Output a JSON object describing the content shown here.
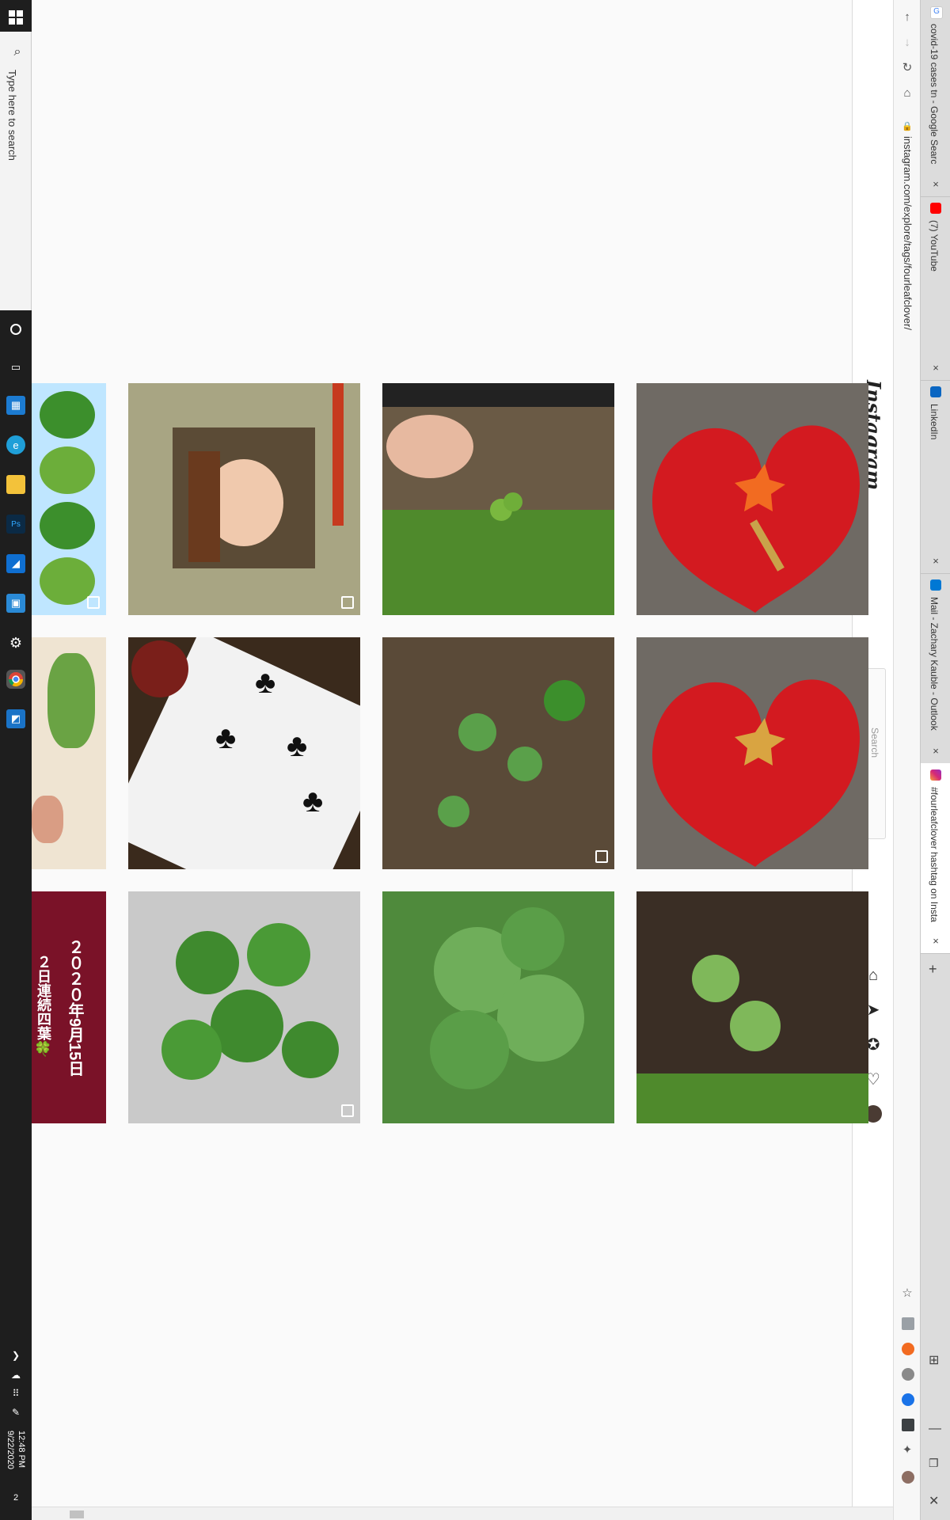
{
  "taskbar": {
    "search_placeholder": "Type here to search",
    "time": "12:48 PM",
    "date": "9/22/2020",
    "notification_count": "2"
  },
  "browser": {
    "tabs": [
      {
        "title": "covid-19 cases tn - Google Searc"
      },
      {
        "title": "(7) YouTube"
      },
      {
        "title": "LinkedIn"
      },
      {
        "title": "Mail - Zachary Kauble - Outlook"
      },
      {
        "title": "#fourleafclover hashtag on Insta"
      }
    ],
    "address": "instagram.com/explore/tags/fourleafclover/",
    "new_tab": "+"
  },
  "instagram": {
    "logo": "Instagram",
    "search_placeholder": "Search"
  },
  "posts": {
    "row3_col1_caption_line1": "２０２０年9月15日",
    "row3_col1_caption_line2": "２日連続四葉🍀"
  },
  "colors": {
    "taskbar_bg": "#1e1e1e",
    "page_bg": "#fafafa",
    "heart_red": "#d31a20",
    "clover_green": "#3f8a2e"
  }
}
